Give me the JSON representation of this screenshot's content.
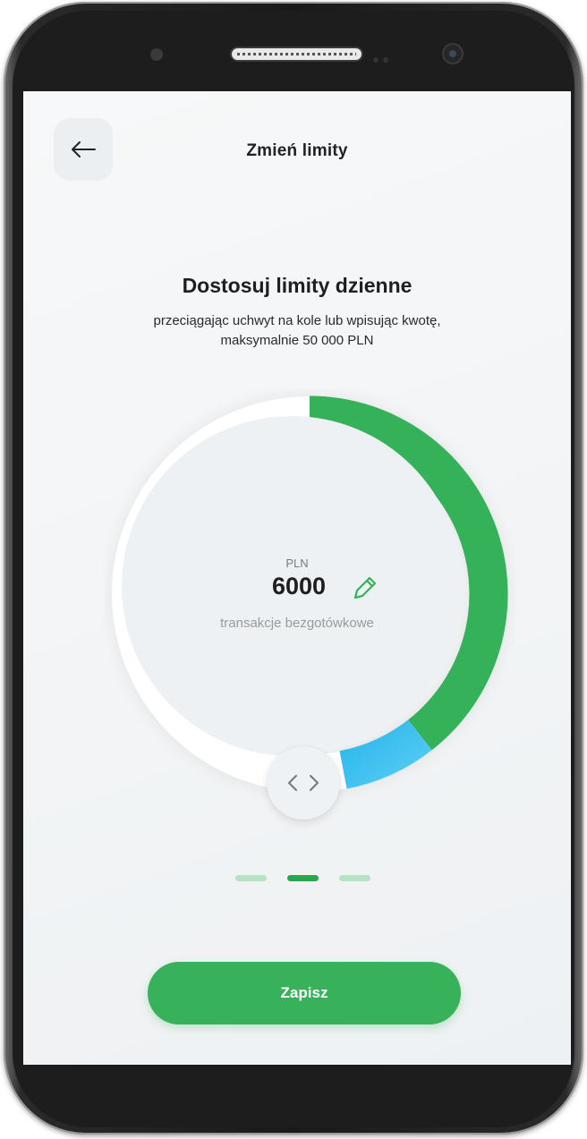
{
  "header": {
    "title": "Zmień limity",
    "back_icon": "arrow-left-icon"
  },
  "intro": {
    "heading": "Dostosuj limity dzienne",
    "subtitle_line1": "przeciągając uchwyt na kole lub wpisując kwotę,",
    "subtitle_line2": "maksymalnie 50 000 PLN"
  },
  "limit_dial": {
    "currency": "PLN",
    "value": "6000",
    "caption": "transakcje bezgotówkowe",
    "edit_icon": "pencil-icon",
    "handle_icon": "chevrons-left-right-icon",
    "max_value": 50000,
    "colors": {
      "primary_arc": "#35b259",
      "secondary_arc": "#2dbbee",
      "track": "#ffffff"
    }
  },
  "pager": {
    "count": 3,
    "active_index": 1,
    "active_color": "#2aa64d",
    "inactive_color": "#b7e2c3"
  },
  "actions": {
    "save_label": "Zapisz",
    "save_color": "#37b25a"
  }
}
